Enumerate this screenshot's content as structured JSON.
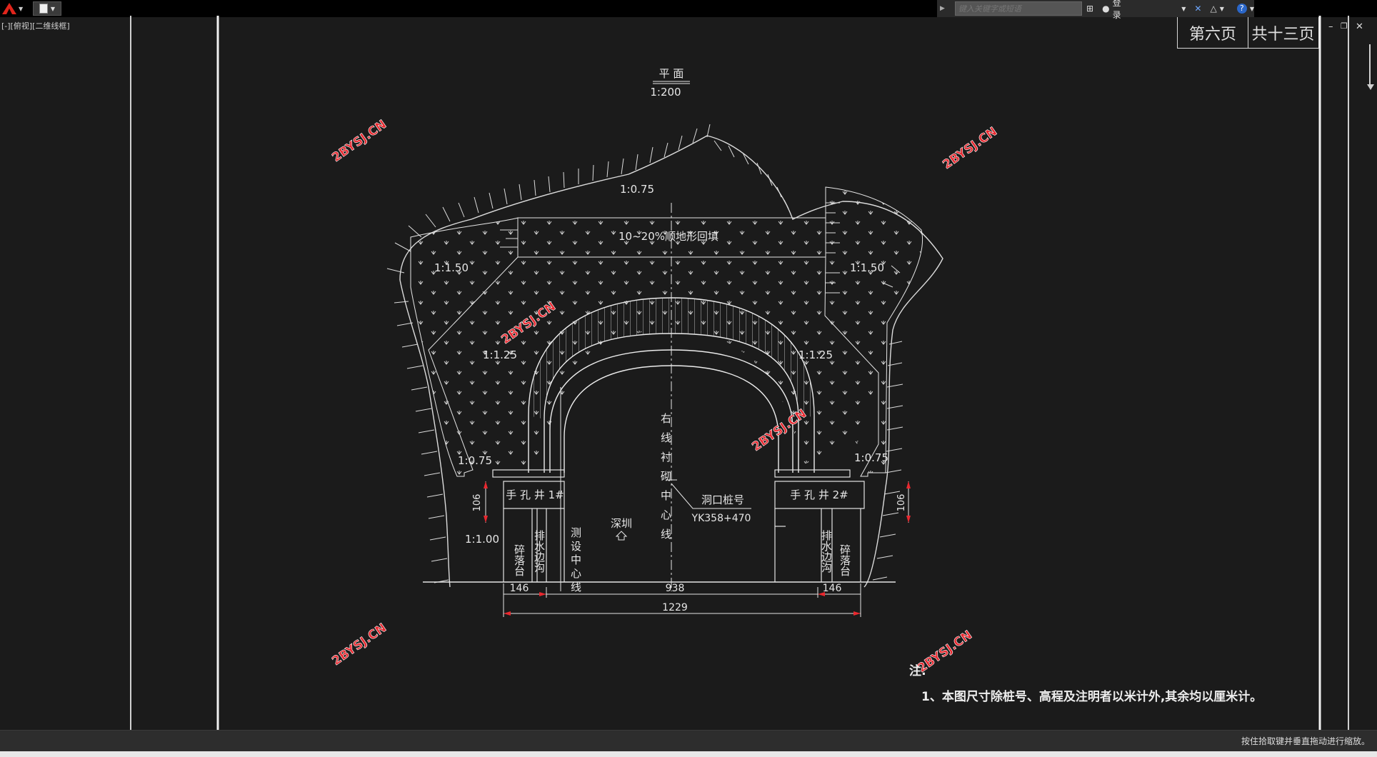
{
  "toolbar": {
    "search_placeholder": "键入关键字或短语",
    "login_label": "登录"
  },
  "viewport": {
    "label": "[-][俯视][二维线框]"
  },
  "page_tabs": {
    "current": "第六页",
    "total": "共十三页"
  },
  "drawing": {
    "plan_title": "平  面",
    "plan_scale": "1:200",
    "backfill_label": "10~20%顺地形回填",
    "slopes": {
      "top": "1:0.75",
      "upper_left": "1:1.50",
      "upper_right": "1:1.50",
      "mid_left": "1:1.25",
      "mid_right": "1:1.25",
      "low_left": "1:0.75",
      "low_right": "1:0.75",
      "bottom_left": "1:1.00"
    },
    "hand_well_1": "手 孔 井 1#",
    "hand_well_2": "手 孔 井 2#",
    "drain_left": "排水边沟",
    "drain_right": "排水边沟",
    "platform_left": "碎落台",
    "platform_right": "碎落台",
    "survey_line": "测设中心线",
    "lining_line": "右线衬砌中心线",
    "direction": "深圳",
    "portal_label": "洞口桩号",
    "portal_station": "YK358+470",
    "dim_106_left": "106",
    "dim_106_right": "106",
    "dim_146_left": "146",
    "dim_938": "938",
    "dim_146_right": "146",
    "dim_1229": "1229",
    "watermark": "2BYSJ.CN",
    "note_title": "注:",
    "note_1": "1、本图尺寸除桩号、高程及注明者以米计外,其余均以厘米计。"
  },
  "status": {
    "hint": "按住拾取键并垂直拖动进行缩放。"
  },
  "colors": {
    "background": "#1b1b1b",
    "lines": "#e6e6e6",
    "watermark": "#e8282f"
  }
}
